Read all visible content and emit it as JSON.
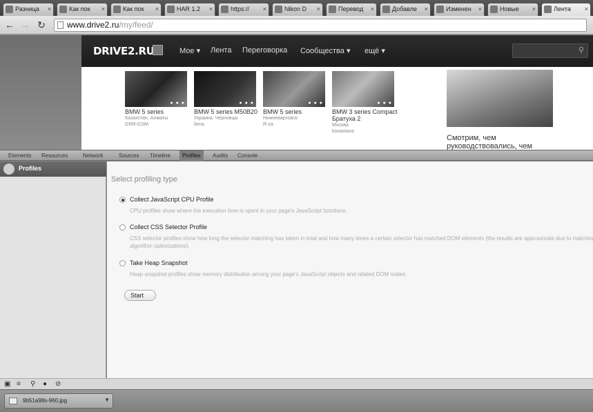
{
  "browser": {
    "tabs": [
      {
        "label": "Разница"
      },
      {
        "label": "Как пок"
      },
      {
        "label": "Как пок"
      },
      {
        "label": "HAR 1.2"
      },
      {
        "label": "https://"
      },
      {
        "label": "Nikon D"
      },
      {
        "label": "Перевод"
      },
      {
        "label": "Добавле"
      },
      {
        "label": "Изменен"
      },
      {
        "label": "Новые"
      },
      {
        "label": "Лента"
      }
    ],
    "url_host": "www.drive2.ru",
    "url_path": "/my/feed/"
  },
  "site": {
    "logo": "DRIVE2.RU",
    "nav": [
      "Мое ▾",
      "Лента",
      "Переговорка",
      "Сообщества ▾",
      "ещё ▾"
    ],
    "cards": [
      {
        "title": "BMW 5 series",
        "meta1": "Казахстан, Алматы",
        "meta2": "GRR-GSM"
      },
      {
        "title": "BMW 5 series M50B20",
        "meta1": "Украина, Черновцы",
        "meta2": "liena"
      },
      {
        "title": "BMW 5 series",
        "meta1": "Нижневартовск",
        "meta2": "R-za"
      },
      {
        "title": "BMW 3 series Compact Братуха 2",
        "meta1": "Москва",
        "meta2": "kooastava"
      }
    ],
    "promo_text": "Смотрим, чем руководствовались, чем"
  },
  "devtools": {
    "tabs": [
      "Elements",
      "Resources",
      "Network",
      "Sources",
      "Timeline",
      "Profiles",
      "Audits",
      "Console"
    ],
    "active_tab": "Profiles",
    "sidebar_item": "Profiles",
    "heading": "Select profiling type",
    "options": [
      {
        "label": "Collect JavaScript CPU Profile",
        "desc": "CPU profiles show where the execution time is spent in your page's JavaScript functions."
      },
      {
        "label": "Collect CSS Selector Profile",
        "desc": "CSS selector profiles show how long the selector matching has taken in total and how many times a certain selector has matched DOM elements (the results are approximate due to matching algorithm optimizations)."
      },
      {
        "label": "Take Heap Snapshot",
        "desc": "Heap snapshot profiles show memory distribution among your page's JavaScript objects and related DOM nodes."
      }
    ],
    "start_label": "Start"
  },
  "downloads": {
    "file": "9b51a98s-960.jpg"
  }
}
